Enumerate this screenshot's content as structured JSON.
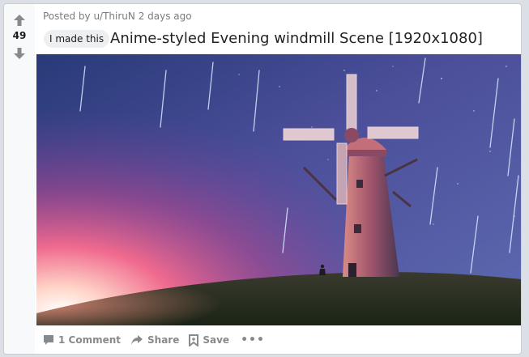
{
  "post": {
    "score": "49",
    "posted_by": "Posted by u/ThiruN 2 days ago",
    "flair": "I made this",
    "title": "Anime-styled Evening windmill Scene [1920x1080]",
    "image_alt": "Anime-styled Evening windmill Scene"
  },
  "actions": {
    "comment_label": "1 Comment",
    "share_label": "Share",
    "save_label": "Save",
    "more_label": "•••"
  },
  "colors": {
    "card_bg": "#ffffff",
    "vote_bg": "#f8f9fa",
    "meta_text": "#787c7e",
    "action_text": "#878a8c"
  },
  "icons": [
    "upvote-arrow-icon",
    "downvote-arrow-icon",
    "comment-icon",
    "share-icon",
    "bookmark-icon",
    "more-options-icon"
  ]
}
